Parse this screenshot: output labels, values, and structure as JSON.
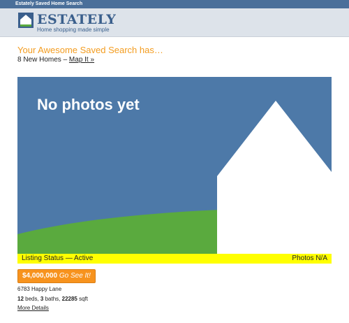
{
  "topbar": {
    "title": "Estately Saved Home Search"
  },
  "brand": {
    "name": "ESTATELY",
    "tagline": "Home shopping made simple"
  },
  "headline": "Your Awesome Saved Search has…",
  "summary": {
    "count_text": "8 New Homes – ",
    "map_link": "Map It »"
  },
  "listing": {
    "photo_placeholder": "No photos yet",
    "status": "Listing Status — Active",
    "photos": "Photos N/A",
    "price": "$4,000,000",
    "cta": "Go See It!",
    "address": "6783 Happy Lane",
    "beds": "12",
    "beds_label": " beds, ",
    "baths": "3",
    "baths_label": " baths, ",
    "sqft": "22285",
    "sqft_label": " sqft",
    "more_link": "More Details"
  },
  "colors": {
    "brand_blue": "#3a5f8c",
    "sky": "#4d79a8",
    "grass": "#5aaa3e",
    "status_yellow": "#ffff00",
    "accent_orange": "#f7931e"
  }
}
